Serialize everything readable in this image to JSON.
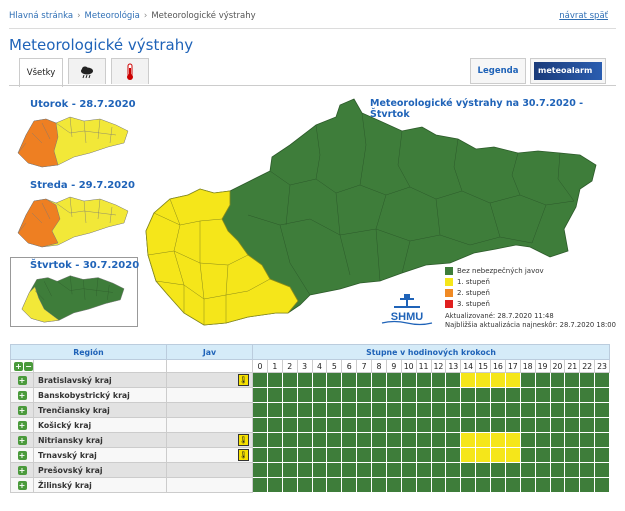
{
  "breadcrumb": {
    "items": [
      "Hlavná stránka",
      "Meteorológia",
      "Meteorologické výstrahy"
    ],
    "back": "návrat späť"
  },
  "page_title": "Meteorologické výstrahy",
  "tabs": [
    {
      "label": "Všetky"
    },
    {
      "icon": "storm-cloud-icon"
    },
    {
      "icon": "thermometer-icon"
    }
  ],
  "buttons": {
    "legend": "Legenda",
    "meteoalarm": "meteoalarm"
  },
  "days": [
    {
      "label": "Utorok - 28.7.2020"
    },
    {
      "label": "Streda - 29.7.2020"
    },
    {
      "label": "Štvrtok - 30.7.2020"
    }
  ],
  "map": {
    "title": "Meteorologické výstrahy na 30.7.2020 - Štvrtok",
    "legend": [
      {
        "label": "Bez nebezpečných javov",
        "color": "#3e7d3a"
      },
      {
        "label": "1. stupeň",
        "color": "#f5e61a"
      },
      {
        "label": "2. stupeň",
        "color": "#f08a24"
      },
      {
        "label": "3. stupeň",
        "color": "#e02020"
      }
    ],
    "logo": "SHMU",
    "updated": "Aktualizované: 28.7.2020 11:48",
    "next_update": "Najbližšia aktualizácia najneskôr: 28.7.2020 18:00"
  },
  "table": {
    "headers": {
      "region": "Región",
      "jav": "Jav",
      "steps": "Stupne v hodinových krokoch"
    },
    "hours": [
      "0",
      "1",
      "2",
      "3",
      "4",
      "5",
      "6",
      "7",
      "8",
      "9",
      "10",
      "11",
      "12",
      "13",
      "14",
      "15",
      "16",
      "17",
      "18",
      "19",
      "20",
      "21",
      "22",
      "23"
    ],
    "rows": [
      {
        "name": "Bratislavský kraj",
        "warn": true,
        "levels": [
          0,
          0,
          0,
          0,
          0,
          0,
          0,
          0,
          0,
          0,
          0,
          0,
          0,
          0,
          1,
          1,
          1,
          1,
          0,
          0,
          0,
          0,
          0,
          0
        ]
      },
      {
        "name": "Banskobystrický kraj",
        "warn": false,
        "levels": [
          0,
          0,
          0,
          0,
          0,
          0,
          0,
          0,
          0,
          0,
          0,
          0,
          0,
          0,
          0,
          0,
          0,
          0,
          0,
          0,
          0,
          0,
          0,
          0
        ]
      },
      {
        "name": "Trenčiansky kraj",
        "warn": false,
        "levels": [
          0,
          0,
          0,
          0,
          0,
          0,
          0,
          0,
          0,
          0,
          0,
          0,
          0,
          0,
          0,
          0,
          0,
          0,
          0,
          0,
          0,
          0,
          0,
          0
        ]
      },
      {
        "name": "Košický kraj",
        "warn": false,
        "levels": [
          0,
          0,
          0,
          0,
          0,
          0,
          0,
          0,
          0,
          0,
          0,
          0,
          0,
          0,
          0,
          0,
          0,
          0,
          0,
          0,
          0,
          0,
          0,
          0
        ]
      },
      {
        "name": "Nitriansky kraj",
        "warn": true,
        "levels": [
          0,
          0,
          0,
          0,
          0,
          0,
          0,
          0,
          0,
          0,
          0,
          0,
          0,
          0,
          1,
          1,
          1,
          1,
          0,
          0,
          0,
          0,
          0,
          0
        ]
      },
      {
        "name": "Trnavský kraj",
        "warn": true,
        "levels": [
          0,
          0,
          0,
          0,
          0,
          0,
          0,
          0,
          0,
          0,
          0,
          0,
          0,
          0,
          1,
          1,
          1,
          1,
          0,
          0,
          0,
          0,
          0,
          0
        ]
      },
      {
        "name": "Prešovský kraj",
        "warn": false,
        "levels": [
          0,
          0,
          0,
          0,
          0,
          0,
          0,
          0,
          0,
          0,
          0,
          0,
          0,
          0,
          0,
          0,
          0,
          0,
          0,
          0,
          0,
          0,
          0,
          0
        ]
      },
      {
        "name": "Žilinský kraj",
        "warn": false,
        "levels": [
          0,
          0,
          0,
          0,
          0,
          0,
          0,
          0,
          0,
          0,
          0,
          0,
          0,
          0,
          0,
          0,
          0,
          0,
          0,
          0,
          0,
          0,
          0,
          0
        ]
      }
    ]
  }
}
